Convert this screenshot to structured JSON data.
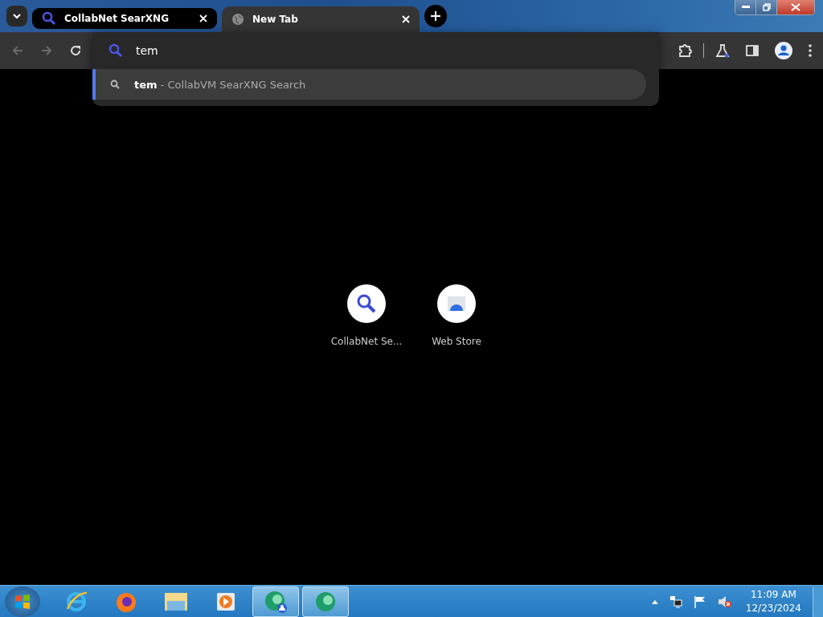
{
  "tabs": [
    {
      "title": "CollabNet SearXNG",
      "kind": "search",
      "selected": false
    },
    {
      "title": "New Tab",
      "kind": "blank",
      "selected": true
    }
  ],
  "omnibox": {
    "value": "tem",
    "suggestions": [
      {
        "query": "tem",
        "description": " - CollabVM SearXNG Search",
        "selected": true
      }
    ]
  },
  "shortcuts": [
    {
      "label": "CollabNet Se...",
      "kind": "search"
    },
    {
      "label": "Web Store",
      "kind": "store"
    }
  ],
  "taskbar": {
    "apps": [
      {
        "kind": "ie",
        "running": false
      },
      {
        "kind": "firefox",
        "running": false
      },
      {
        "kind": "explorer",
        "running": false
      },
      {
        "kind": "media",
        "running": false
      },
      {
        "kind": "collabvm-user",
        "running": true
      },
      {
        "kind": "collabvm",
        "running": true
      }
    ],
    "time": "11:09 AM",
    "date": "12/23/2024"
  }
}
